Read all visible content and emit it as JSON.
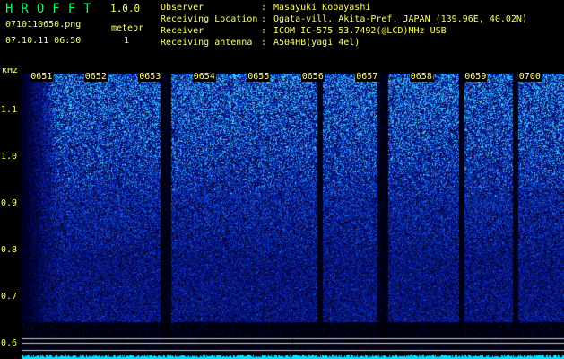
{
  "app": {
    "title": "HROFFT",
    "version": "1.0.0",
    "file": "0710110650.png",
    "datetime": "07.10.11 06:50",
    "meteor_label": "meteor",
    "meteor_count": "1"
  },
  "info": [
    {
      "label": "Observer",
      "value": "Masayuki Kobayashi"
    },
    {
      "label": "Receiving Location",
      "value": "Ogata-vill. Akita-Pref. JAPAN (139.96E, 40.02N)"
    },
    {
      "label": "Receiver",
      "value": "ICOM IC-575 53.7492(@LCD)MHz USB"
    },
    {
      "label": "Receiving antenna",
      "value": "A504HB(yagi 4el)"
    }
  ],
  "separator": ":",
  "colors": {
    "label_text": "#ffff66",
    "title_text": "#00ff66",
    "noise_dark": "#0a1a66",
    "noise_bright": "#3aa0ff",
    "signal": "#00ffee"
  },
  "chart_data": {
    "type": "heatmap",
    "ylabel": "kHz",
    "y_ticks": [
      "1.1",
      "1.0",
      "0.9",
      "0.8",
      "0.7",
      "0.6"
    ],
    "x_ticks": [
      "0651",
      "0652",
      "0653",
      "0654",
      "0655",
      "0656",
      "0657",
      "0658",
      "0659",
      "0700"
    ],
    "ylim": [
      0.57,
      1.18
    ],
    "xlim": [
      0,
      10
    ],
    "reference_lines_khz": [
      0.615,
      0.605,
      0.59
    ],
    "dark_gaps_min": [
      [
        2.55,
        2.75
      ],
      [
        5.45,
        5.55
      ],
      [
        6.55,
        6.75
      ],
      [
        8.05,
        8.15
      ],
      [
        9.05,
        9.15
      ]
    ]
  }
}
